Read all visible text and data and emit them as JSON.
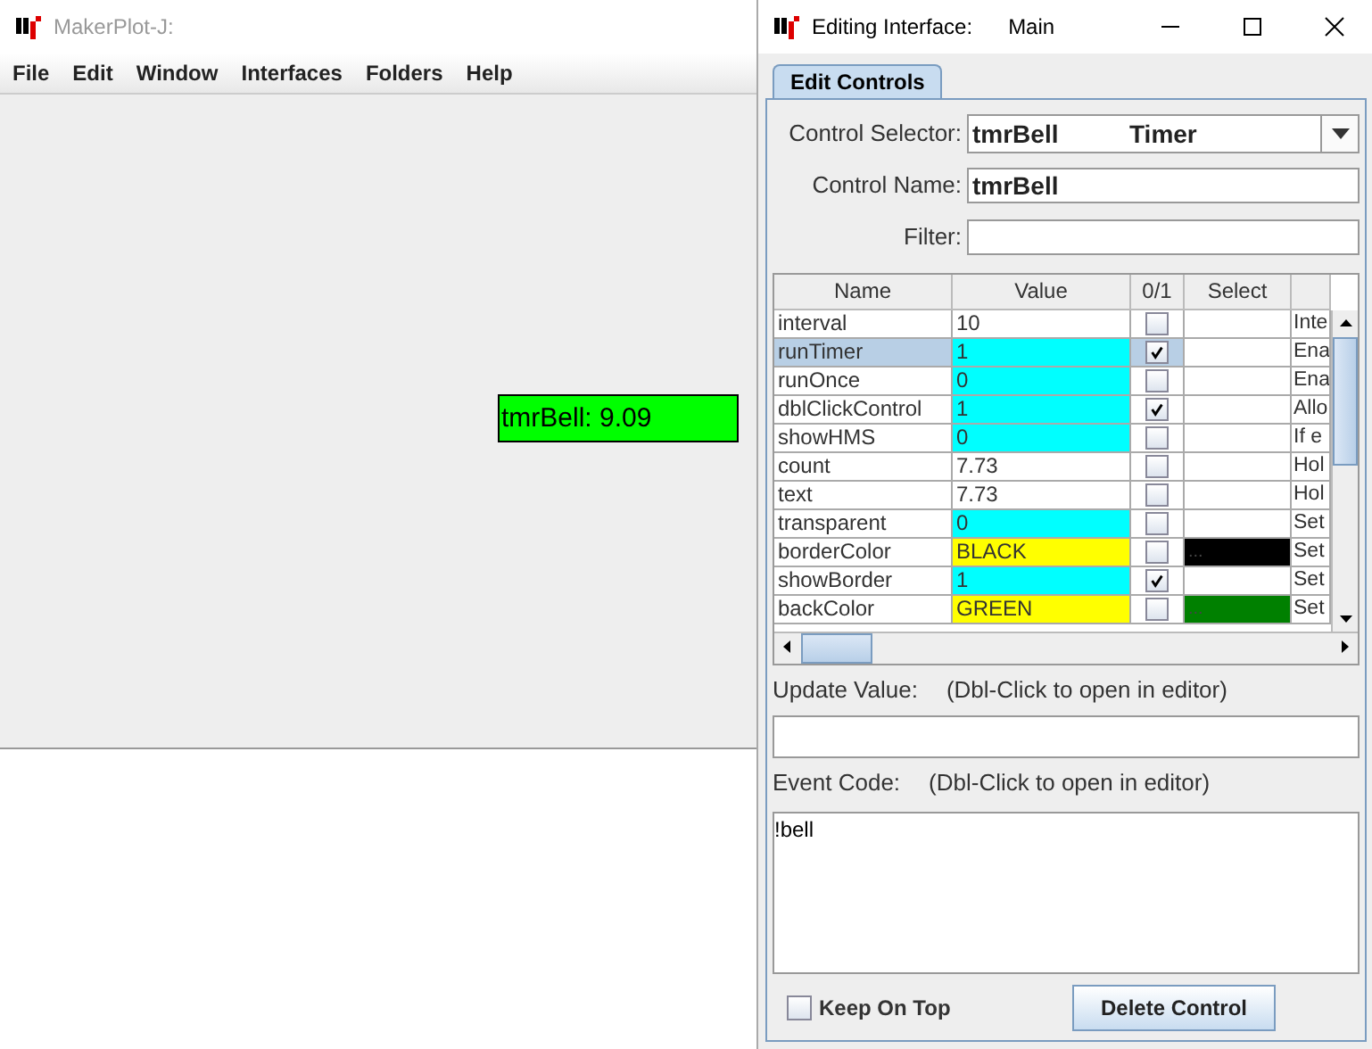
{
  "main_window": {
    "title": "MakerPlot-J:",
    "menu": [
      "File",
      "Edit",
      "Window",
      "Interfaces",
      "Folders",
      "Help"
    ],
    "timer_label": {
      "text": "tmrBell: 9.09",
      "color": "#00ff00"
    }
  },
  "dialog": {
    "title": "Editing Interface:",
    "interface": "Main",
    "tabs": [
      {
        "label": "Edit Controls",
        "selected": true
      }
    ],
    "control_selector": {
      "label": "Control Selector:",
      "name": "tmrBell",
      "type": "Timer"
    },
    "control_name": {
      "label": "Control Name:",
      "value": "tmrBell"
    },
    "filter": {
      "label": "Filter:"
    },
    "table": {
      "columns": [
        "Name",
        "Value",
        "0/1",
        "Select"
      ],
      "rows": [
        {
          "name": "interval",
          "value": "10",
          "kind": "plain",
          "checked": false,
          "selected": false,
          "description": "Inte"
        },
        {
          "name": "runTimer",
          "value": "1",
          "kind": "flag",
          "checked": true,
          "selected": true,
          "description": "Ena"
        },
        {
          "name": "runOnce",
          "value": "0",
          "kind": "flag",
          "checked": false,
          "selected": false,
          "description": "Ena"
        },
        {
          "name": "dblClickControl",
          "value": "1",
          "kind": "flag",
          "checked": true,
          "selected": false,
          "description": "Allo"
        },
        {
          "name": "showHMS",
          "value": "0",
          "kind": "flag",
          "checked": false,
          "selected": false,
          "description": "If e"
        },
        {
          "name": "count",
          "value": "7.73",
          "kind": "plain",
          "checked": false,
          "selected": false,
          "description": "Hol"
        },
        {
          "name": "text",
          "value": "7.73",
          "kind": "plain",
          "checked": false,
          "selected": false,
          "description": "Hol"
        },
        {
          "name": "transparent",
          "value": "0",
          "kind": "flag",
          "checked": false,
          "selected": false,
          "description": "Set"
        },
        {
          "name": "borderColor",
          "value": "BLACK",
          "kind": "color",
          "color": "#000000",
          "swatch": "...",
          "checked": false,
          "selected": false,
          "description": "Set"
        },
        {
          "name": "showBorder",
          "value": "1",
          "kind": "flag",
          "checked": true,
          "selected": false,
          "description": "Set"
        },
        {
          "name": "backColor",
          "value": "GREEN",
          "kind": "color",
          "color": "#008000",
          "swatch": "...",
          "checked": false,
          "selected": false,
          "description": "Set"
        }
      ]
    },
    "update_value": {
      "label": "Update Value:",
      "hint": "(Dbl-Click to open in editor)"
    },
    "event_code": {
      "label": "Event Code:",
      "hint": "(Dbl-Click to open in editor)",
      "value": "!bell"
    },
    "keep_on_top": {
      "label": "Keep On Top",
      "checked": false
    },
    "delete_button": "Delete Control"
  }
}
